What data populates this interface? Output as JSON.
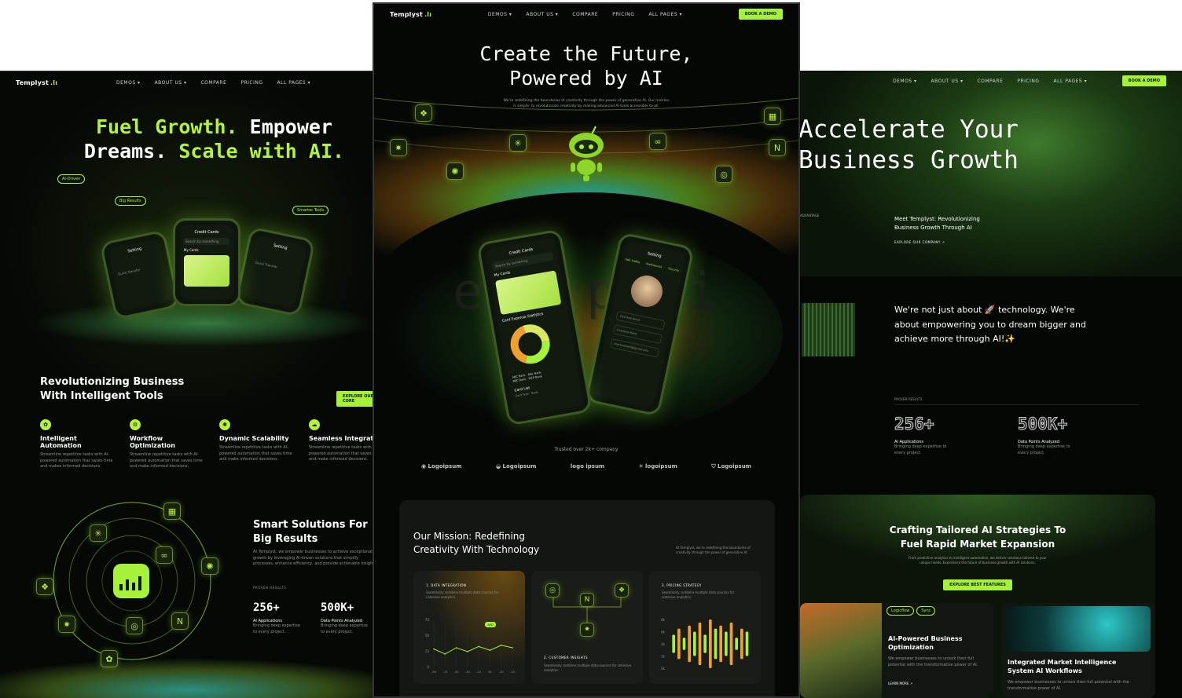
{
  "brand": {
    "name": "Templyst",
    "bars": ".lı",
    "accent": "#b6f23a"
  },
  "nav": {
    "items": [
      "DEMOS ▾",
      "ABOUT US ▾",
      "COMPARE",
      "PRICING",
      "ALL PAGES ▾"
    ],
    "cta": "BOOK A DEMO"
  },
  "left": {
    "hero_l1a": "Fuel Growth.",
    "hero_l1b": "Empower",
    "hero_l2a": "Dreams.",
    "hero_l2b": "Scale with AI.",
    "tags": [
      "AI-Driven",
      "Big Results",
      "Smarter Tools"
    ],
    "phone": {
      "title": "Credit Cards",
      "search": "Search by something",
      "section": "My Cards",
      "setting": "Setting",
      "quick": "Quick Transfer"
    },
    "section_title_1": "Revolutionizing Business",
    "section_title_2": "With Intelligent Tools",
    "explore_btn": "EXPLORE OUR CORE",
    "features": [
      {
        "title": "Intelligent Automation",
        "desc": "Streamline repetitive tasks with AI-powered automation that saves time and makes informed decisions."
      },
      {
        "title": "Workflow Optimization",
        "desc": "Streamline repetitive tasks with AI-powered automation that saves time and make informed decisions."
      },
      {
        "title": "Dynamic Scalability",
        "desc": "Streamline repetitive tasks with AI-powered automation that saves time and make informed decisions."
      },
      {
        "title": "Seamless Integrat",
        "desc": "Streamline repetitive tasks with AI-powered automation that saves time and make informed decisions."
      }
    ],
    "smart_1": "Smart Solutions For",
    "smart_2": "Big Results",
    "smart_desc": "At Templyst, we empower businesses to achieve exceptional growth by leveraging AI-driven solutions that simplify processes, enhance efficiency, and provide actionable insights.",
    "proven": "PROVEN RESULTS",
    "stats": [
      {
        "num": "256+",
        "label": "AI Applications",
        "desc": "Bringing deep expertise to every project."
      },
      {
        "num": "500K+",
        "label": "Data Points Analyzed",
        "desc": "Bringing deep expertise to every project."
      }
    ]
  },
  "center": {
    "hero_1": "Create the Future,",
    "hero_2": "Powered by AI",
    "hero_desc_1": "We're redefining the boundaries of creativity through the power of generative AI. Our mission",
    "hero_desc_2": "is simple: to revolutionize creativity by making advanced AI tools accessible to all.",
    "phone_a": {
      "title": "Credit Cards",
      "search": "Search by something",
      "section": "My Cards",
      "stats": "Card Expense Statistics",
      "legend": [
        "ABC Bank",
        "DBL Bank",
        "BRC Bank",
        "MCP Bank"
      ],
      "list": "Card List",
      "card_type": "Card Type",
      "bank": "Bank"
    },
    "phone_b": {
      "title": "Setting",
      "tabs": [
        "Edit Profile",
        "Preferences",
        "Security"
      ],
      "fields": [
        "Charlene Reed",
        "Charlene Reed",
        "charlenereed@gmail.com"
      ]
    },
    "watermark": "esi   pici",
    "trusted": "Trusted over 2k+ company",
    "logos": [
      "Logoipsum",
      "Logoipsum",
      "logo ipsum",
      "logoipsum",
      "Logoipsum"
    ],
    "mission_1": "Our Mission: Redefining",
    "mission_2": "Creativity With Technology",
    "mission_desc": "At Templyst, we're redefining the boundaries of creativity through the power of generative AI.",
    "cards": [
      {
        "num": "1. DATA INTEGRATION",
        "desc": "Seamlessly combine multiple data sources for cohesive analytics."
      },
      {
        "num": "2. CUSTOMER INSIGHTS",
        "desc": "Seamlessly combine multiple data sources for cohesive analytics."
      },
      {
        "num": "3. PRICING STRATEGY",
        "desc": "Seamlessly combine multiple data sources for cohesive analytics."
      }
    ],
    "line_badge": "AED",
    "line_yticks": [
      "75",
      "50",
      "25",
      "0"
    ],
    "line_xticks": [
      "-90",
      "-70",
      "-50",
      "-30",
      "-10",
      "00",
      "-20",
      "-10"
    ],
    "bar_yticks": [
      "8k",
      "6k",
      "4k",
      "2k",
      "0k"
    ]
  },
  "right": {
    "hero_1": "Accelerate Your",
    "hero_2": "Business Growth",
    "advantage": "ADVANTAGE",
    "meet_1": "Meet Templyst: Revolutionizing",
    "meet_2": "Business Growth Through AI",
    "explore": "EXPLORE OUR COMPANY",
    "about_1": "We're not just about 🚀 technology. We're",
    "about_2": "about empowering you to dream bigger and",
    "about_3": "achieve more through AI!✨",
    "proven": "PROVEN RESULTS",
    "stats": [
      {
        "num": "256+",
        "label": "AI Applications",
        "desc": "Bringing deep expertise to every project."
      },
      {
        "num": "500K+",
        "label": "Data Points Analyzed",
        "desc": "Bringing deep expertise to every project."
      }
    ],
    "craft_1": "Crafting Tailored AI Strategies To",
    "craft_2": "Fuel Rapid Market Expansion",
    "craft_desc_1": "From predictive analytics to intelligent automation, we deliver solutions tailored to your",
    "craft_desc_2": "unique needs. Experience the future of business growth with AI solutions.",
    "craft_btn": "EXPLORE BEST FEATURES",
    "feat_cards": [
      {
        "title_1": "AI-Powered Business",
        "title_2": "Optimization",
        "desc": "We empower businesses to unlock their full potential with the transformative power of AI.",
        "link": "LEARN MORE ↗"
      },
      {
        "title_1": "Integrated Market Intelligence",
        "title_2": "System AI Workflows",
        "desc": "We empower businesses to unlock their full potential with the transformative power of AI."
      }
    ],
    "pills": [
      "Logicflow",
      "Sync"
    ]
  },
  "chart_data": [
    {
      "type": "line",
      "title": "",
      "x": [
        "-90",
        "-70",
        "-50",
        "-30",
        "-10",
        "00",
        "-20",
        "-10"
      ],
      "series": [
        {
          "values": [
            28,
            20,
            30,
            24,
            32,
            26,
            34,
            30
          ]
        }
      ],
      "ylim": [
        0,
        75
      ]
    },
    {
      "type": "bar",
      "title": "",
      "values": [
        3,
        5,
        2,
        6,
        4,
        7,
        3,
        8,
        5,
        6,
        4,
        7,
        2,
        5,
        4
      ],
      "ylim": [
        0,
        8
      ]
    }
  ]
}
